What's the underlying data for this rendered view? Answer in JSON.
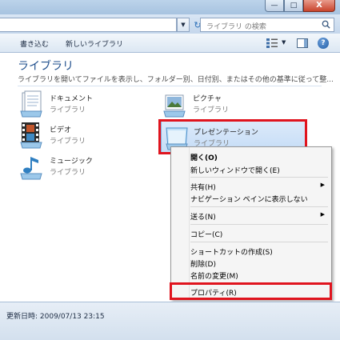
{
  "window": {
    "minimize_glyph": "—",
    "maximize_glyph": "□",
    "close_glyph": "X"
  },
  "address": {
    "dropdown_glyph": "▼",
    "refresh_glyph": "↻"
  },
  "search": {
    "placeholder": "ライブラリ の検索"
  },
  "toolbar": {
    "write_label": "書き込む",
    "new_library_label": "新しいライブラリ",
    "view_dropdown_glyph": "▼",
    "help_glyph": "?"
  },
  "content": {
    "title": "ライブラリ",
    "description": "ライブラリを開いてファイルを表示し、フォルダー別、日付別、またはその他の基準に従って整..."
  },
  "libraries": [
    {
      "name": "ドキュメント",
      "sub": "ライブラリ",
      "icon": "documents-library-icon"
    },
    {
      "name": "ピクチャ",
      "sub": "ライブラリ",
      "icon": "pictures-library-icon"
    },
    {
      "name": "ビデオ",
      "sub": "ライブラリ",
      "icon": "videos-library-icon"
    },
    {
      "name": "プレゼンテーション",
      "sub": "ライブラリ",
      "icon": "presentation-library-icon"
    },
    {
      "name": "ミュージック",
      "sub": "ライブラリ",
      "icon": "music-library-icon"
    }
  ],
  "context_menu": {
    "items": [
      {
        "label": "開く(O)",
        "bold": true
      },
      {
        "label": "新しいウィンドウで開く(E)"
      },
      {
        "label": "共有(H)",
        "submenu": true
      },
      {
        "label": "ナビゲーション ペインに表示しない"
      },
      {
        "label": "送る(N)",
        "submenu": true
      },
      {
        "label": "コピー(C)"
      },
      {
        "label": "ショートカットの作成(S)"
      },
      {
        "label": "削除(D)"
      },
      {
        "label": "名前の変更(M)"
      },
      {
        "label": "プロパティ(R)"
      }
    ],
    "submenu_glyph": "▶"
  },
  "status": {
    "text": "更新日時: 2009/07/13 23:15"
  },
  "colors": {
    "highlight_red": "#e0141e",
    "title_blue": "#1e4e8c"
  }
}
